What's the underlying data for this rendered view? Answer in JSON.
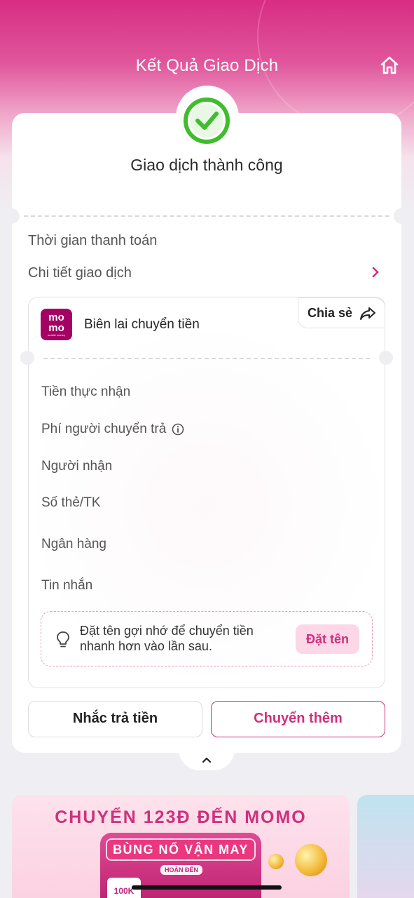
{
  "header": {
    "title": "Kết Quả Giao Dịch",
    "home_icon": "home-icon"
  },
  "status": {
    "text": "Giao dịch thành công",
    "icon": "check-circle-icon",
    "color": "#3fbd2c"
  },
  "summary_rows": {
    "payment_time_label": "Thời gian thanh toán",
    "details_label": "Chi tiết giao dịch"
  },
  "receipt": {
    "title": "Biên lai chuyển tiền",
    "logo_top": "mo",
    "logo_bottom": "mo",
    "logo_caption": "mobile money",
    "share_label": "Chia sẻ",
    "fields": {
      "received_amount": "Tiền thực nhận",
      "fee": "Phí người chuyển trả",
      "recipient": "Người nhận",
      "account": "Số thẻ/TK",
      "bank": "Ngân hàng",
      "message": "Tin nhắn"
    },
    "tip_text": "Đặt tên gợi nhớ để chuyển tiền nhanh hơn vào lần sau.",
    "name_button": "Đặt tên"
  },
  "actions": {
    "remind_label": "Nhắc trả tiền",
    "transfer_more_label": "Chuyển thêm"
  },
  "banner": {
    "title": "CHUYỂN 123Đ ĐẾN MOMO",
    "subtitle": "BÙNG NỔ VẬN MAY",
    "small_label": "HOÀN ĐẾN",
    "small_label2": "100K"
  },
  "colors": {
    "brand": "#a50064",
    "accent": "#d0307b",
    "success": "#3fbd2c"
  }
}
